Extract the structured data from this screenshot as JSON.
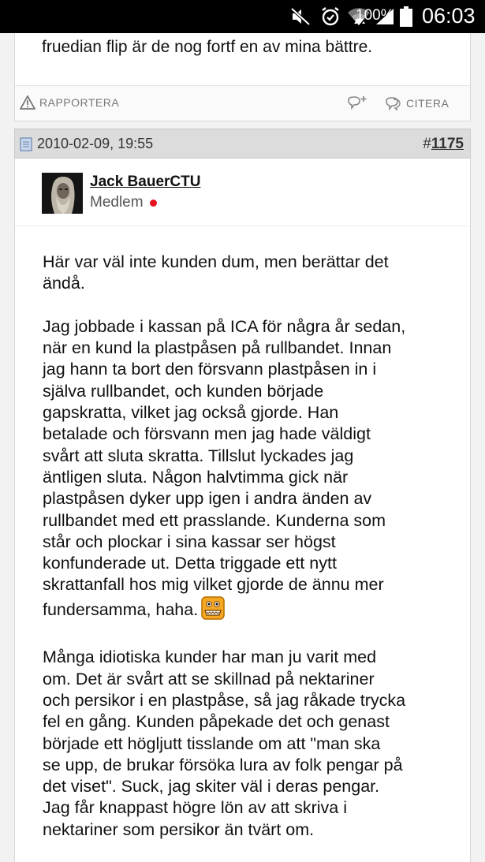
{
  "status_bar": {
    "battery_percent": "100%",
    "time": "06:03",
    "icons": [
      "mute-icon",
      "alarm-icon",
      "wifi-icon",
      "signal-icon",
      "battery-icon"
    ]
  },
  "previous_post": {
    "tail_text": "fruedian flip är de nog fortf en av mina bättre.",
    "report_label": "RAPPORTERA",
    "quote_label": "CITERA"
  },
  "post": {
    "date": "2010-02-09, 19:55",
    "number_prefix": "#",
    "number": "1175",
    "author": {
      "name": "Jack BauerCTU",
      "role": "Medlem",
      "online_color": "#e8121e"
    },
    "paragraphs": [
      "Här var väl inte kunden dum, men berättar det\nändå.",
      "Jag jobbade i kassan på ICA för några år sedan,\nnär en kund la plastpåsen på rullbandet. Innan\njag hann ta bort den försvann plastpåsen in i\nsjälva rullbandet, och kunden började\ngapskratta, vilket jag också gjorde. Han\nbetalade och försvann men jag hade väldigt\nsvårt att sluta skratta. Tillslut lyckades jag\näntligen sluta. Någon halvtimma gick när\nplastpåsen dyker upp igen i andra änden av\nrullbandet med ett prasslande. Kunderna som\nstår och plockar i sina kassar ser högst\nkonfunderade ut. Detta triggade ett nytt\nskrattanfall hos mig vilket gjorde de ännu mer\nfundersamma, haha.",
      "Många idiotiska kunder har man ju varit med\nom. Det är svårt att se skillnad på nektariner\noch persikor i en plastpåse, så jag råkade trycka\nfel en gång. Kunden påpekade det och genast\nbörjade ett högljutt tisslande om att \"man ska\nse upp, de brukar försöka lura av folk pengar på\ndet viset\". Suck, jag skiter väl i deras pengar.\nJag får knappast högre lön av att skriva i\nnektariner som persikor än tvärt om."
    ],
    "emoji_icon": "grin-emoji-icon"
  }
}
